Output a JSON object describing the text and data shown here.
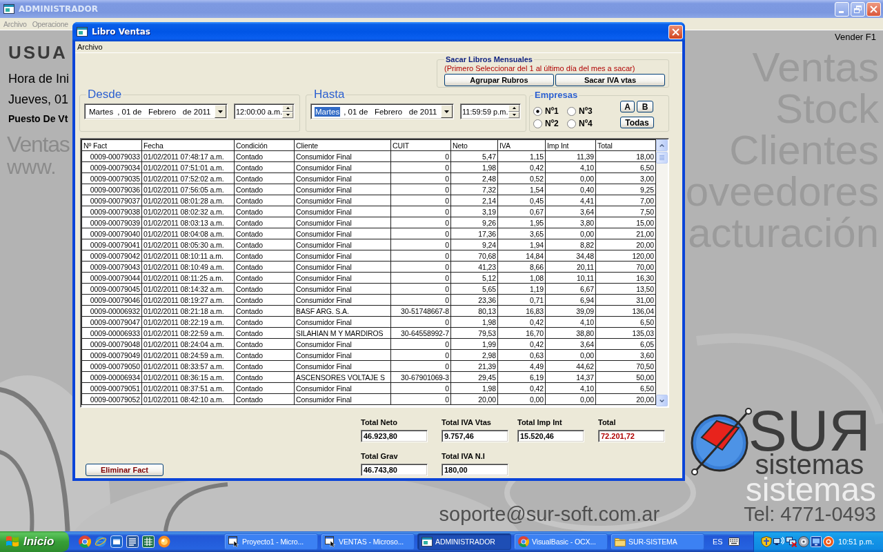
{
  "background_window": {
    "title": "ADMINISTRADOR",
    "active": false,
    "menu": [
      {
        "label": "Archivo",
        "disabled": true
      },
      {
        "label": "Operacione",
        "disabled": true
      }
    ]
  },
  "dialog": {
    "title": "Libro Ventas",
    "active": true,
    "menu": [
      "Archivo"
    ],
    "monthly_books": {
      "title": "Sacar Libros Mensuales",
      "note": "(Primero Seleccionar del 1 al último día del mes a sacar)",
      "buttons": [
        "Agrupar Rubros",
        "Sacar IVA vtas"
      ]
    },
    "date_from": {
      "title": "Desde",
      "weekday": "Martes",
      "weekday_selected": false,
      "date": ", 01 de   Febrero   de 2011",
      "time": "12:00:00 a.m."
    },
    "date_to": {
      "title": "Hasta",
      "weekday": "Martes",
      "weekday_selected": true,
      "date": ", 01 de   Febrero   de 2011",
      "time": "11:59:59 p.m."
    },
    "companies": {
      "title": "Empresas",
      "options": [
        {
          "label": "Nº1",
          "selected": true
        },
        {
          "label": "Nº2",
          "selected": false
        },
        {
          "label": "Nº3",
          "selected": false
        },
        {
          "label": "Nº4",
          "selected": false
        }
      ],
      "buttons": [
        "A",
        "B",
        "Todas"
      ]
    },
    "table": {
      "columns": [
        "Nº Fact",
        "Fecha",
        "Condición",
        "Cliente",
        "CUIT",
        "Neto",
        "IVA",
        "Imp Int",
        "Total"
      ],
      "rows": [
        [
          "0009-00079033",
          "01/02/2011 07:48:17 a.m.",
          "Contado",
          "Consumidor Final",
          "0",
          "5,47",
          "1,15",
          "11,39",
          "18,00"
        ],
        [
          "0009-00079034",
          "01/02/2011 07:51:01 a.m.",
          "Contado",
          "Consumidor Final",
          "0",
          "1,98",
          "0,42",
          "4,10",
          "6,50"
        ],
        [
          "0009-00079035",
          "01/02/2011 07:52:02 a.m.",
          "Contado",
          "Consumidor Final",
          "0",
          "2,48",
          "0,52",
          "0,00",
          "3,00"
        ],
        [
          "0009-00079036",
          "01/02/2011 07:56:05 a.m.",
          "Contado",
          "Consumidor Final",
          "0",
          "7,32",
          "1,54",
          "0,40",
          "9,25"
        ],
        [
          "0009-00079037",
          "01/02/2011 08:01:28 a.m.",
          "Contado",
          "Consumidor Final",
          "0",
          "2,14",
          "0,45",
          "4,41",
          "7,00"
        ],
        [
          "0009-00079038",
          "01/02/2011 08:02:32 a.m.",
          "Contado",
          "Consumidor Final",
          "0",
          "3,19",
          "0,67",
          "3,64",
          "7,50"
        ],
        [
          "0009-00079039",
          "01/02/2011 08:03:13 a.m.",
          "Contado",
          "Consumidor Final",
          "0",
          "9,26",
          "1,95",
          "3,80",
          "15,00"
        ],
        [
          "0009-00079040",
          "01/02/2011 08:04:08 a.m.",
          "Contado",
          "Consumidor Final",
          "0",
          "17,36",
          "3,65",
          "0,00",
          "21,00"
        ],
        [
          "0009-00079041",
          "01/02/2011 08:05:30 a.m.",
          "Contado",
          "Consumidor Final",
          "0",
          "9,24",
          "1,94",
          "8,82",
          "20,00"
        ],
        [
          "0009-00079042",
          "01/02/2011 08:10:11 a.m.",
          "Contado",
          "Consumidor Final",
          "0",
          "70,68",
          "14,84",
          "34,48",
          "120,00"
        ],
        [
          "0009-00079043",
          "01/02/2011 08:10:49 a.m.",
          "Contado",
          "Consumidor Final",
          "0",
          "41,23",
          "8,66",
          "20,11",
          "70,00"
        ],
        [
          "0009-00079044",
          "01/02/2011 08:11:25 a.m.",
          "Contado",
          "Consumidor Final",
          "0",
          "5,12",
          "1,08",
          "10,11",
          "16,30"
        ],
        [
          "0009-00079045",
          "01/02/2011 08:14:32 a.m.",
          "Contado",
          "Consumidor Final",
          "0",
          "5,65",
          "1,19",
          "6,67",
          "13,50"
        ],
        [
          "0009-00079046",
          "01/02/2011 08:19:27 a.m.",
          "Contado",
          "Consumidor Final",
          "0",
          "23,36",
          "0,71",
          "6,94",
          "31,00"
        ],
        [
          "0009-00006932",
          "01/02/2011 08:21:18 a.m.",
          "Contado",
          "BASF ARG. S.A.",
          "30-51748667-8",
          "80,13",
          "16,83",
          "39,09",
          "136,04"
        ],
        [
          "0009-00079047",
          "01/02/2011 08:22:19 a.m.",
          "Contado",
          "Consumidor Final",
          "0",
          "1,98",
          "0,42",
          "4,10",
          "6,50"
        ],
        [
          "0009-00006933",
          "01/02/2011 08:22:59 a.m.",
          "Contado",
          "SILAHIAN M Y MARDIROS",
          "30-64558992-7",
          "79,53",
          "16,70",
          "38,80",
          "135,03"
        ],
        [
          "0009-00079048",
          "01/02/2011 08:24:04 a.m.",
          "Contado",
          "Consumidor Final",
          "0",
          "1,99",
          "0,42",
          "3,64",
          "6,05"
        ],
        [
          "0009-00079049",
          "01/02/2011 08:24:59 a.m.",
          "Contado",
          "Consumidor Final",
          "0",
          "2,98",
          "0,63",
          "0,00",
          "3,60"
        ],
        [
          "0009-00079050",
          "01/02/2011 08:33:57 a.m.",
          "Contado",
          "Consumidor Final",
          "0",
          "21,39",
          "4,49",
          "44,62",
          "70,50"
        ],
        [
          "0009-00006934",
          "01/02/2011 08:36:15 a.m.",
          "Contado",
          "ASCENSORES VOLTAJE S",
          "30-67901069-3",
          "29,45",
          "6,19",
          "14,37",
          "50,00"
        ],
        [
          "0009-00079051",
          "01/02/2011 08:37:51 a.m.",
          "Contado",
          "Consumidor Final",
          "0",
          "1,98",
          "0,42",
          "4,10",
          "6,50"
        ],
        [
          "0009-00079052",
          "01/02/2011 08:42:10 a.m.",
          "Contado",
          "Consumidor Final",
          "0",
          "20,00",
          "0,00",
          "0,00",
          "20,00"
        ]
      ]
    },
    "totals": [
      {
        "label": "Total Neto",
        "value": "46.923,80",
        "color": "#000000"
      },
      {
        "label": "Total IVA Vtas",
        "value": "9.757,46",
        "color": "#000000"
      },
      {
        "label": "Total Imp Int",
        "value": "15.520,46",
        "color": "#000000"
      },
      {
        "label": "Total",
        "value": "72.201,72",
        "color": "#b00000"
      },
      {
        "label": "Total Grav",
        "value": "46.743,80",
        "color": "#000000"
      },
      {
        "label": "Total IVA N.I",
        "value": "180,00",
        "color": "#000000"
      }
    ],
    "delete_button": "Eliminar Fact"
  },
  "user_panel": {
    "heading": "USUA",
    "start_time": "Hora de Ini",
    "date": "Jueves, 01",
    "station": "Puesto De Vt",
    "brand": "Ventas",
    "website": "www."
  },
  "shortcut_hint": "Vender F1",
  "modules": [
    "Ventas",
    "Stock",
    "Clientes",
    "oveedores",
    "acturación"
  ],
  "logo": {
    "name": "SUЯ",
    "tagline": "sistemas"
  },
  "background_wordmark": "sistemas",
  "contact": {
    "email": "soporte@sur-soft.com.ar",
    "phone": "Tel: 4771-0493"
  },
  "taskbar": {
    "start": "Inicio",
    "tasks": [
      {
        "label": "Proyecto1 - Micro...",
        "kind": "project",
        "selected": false
      },
      {
        "label": "VENTAS - Microso...",
        "kind": "project",
        "selected": false
      },
      {
        "label": "ADMINISTRADOR",
        "kind": "window",
        "selected": true
      },
      {
        "label": "VisualBasic - OCX...",
        "kind": "browser",
        "selected": false
      },
      {
        "label": "SUR-SISTEMA",
        "kind": "folder",
        "selected": false
      }
    ],
    "language": "ES",
    "clock": "10:51 p.m."
  }
}
